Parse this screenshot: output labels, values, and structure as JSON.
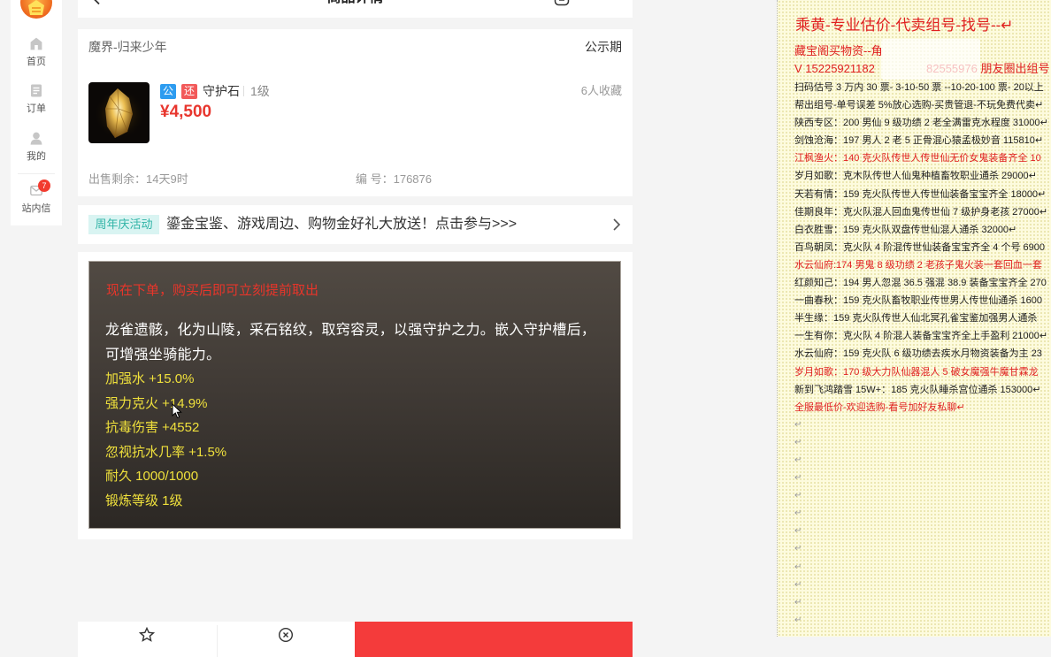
{
  "colors": {
    "accent_red": "#e8362e",
    "badge_public": "#2d9cf0",
    "badge_return": "#f25a5a",
    "promo_tag_bg": "#d9f4f2",
    "promo_tag_text": "#2fb3a6",
    "notice_red": "#e8352a",
    "attribute_yellow": "#efe03c",
    "doc_red": "#e02020",
    "buy_button": "#f43b3b"
  },
  "sidebar": {
    "logo_icon": "logo-icon",
    "items": [
      {
        "label": "首页",
        "icon": "home-icon"
      },
      {
        "label": "订单",
        "icon": "order-icon"
      },
      {
        "label": "我的",
        "icon": "user-icon"
      },
      {
        "label": "站内信",
        "icon": "message-icon",
        "badge": "7"
      }
    ]
  },
  "header": {
    "title": "商品详情",
    "back_icon": "chevron-left-icon",
    "action_icon": "share-icon"
  },
  "listing": {
    "server": "魔界-归来少年",
    "status": "公示期",
    "image": "guardian-stone-image",
    "badges": [
      "公",
      "还"
    ],
    "name": "守护石",
    "level": "1级",
    "price": "¥4,500",
    "favorites": "6人收藏",
    "time_left": "出售剩余：14天9时",
    "serial": "编 号：176876"
  },
  "promo": {
    "tag": "周年庆活动",
    "text": "鎏金宝鉴、游戏周边、购物金好礼大放送！点击参与>>>",
    "icon": "chevron-right-icon"
  },
  "description": {
    "notice": "现在下单，购买后即可立刻提前取出",
    "lore": "龙雀遗骸，化为山陵，采石铭纹，取窍容灵，以强守护之力。嵌入守护槽后，可增强坐骑能力。",
    "attributes": [
      "加强水 +15.0%",
      "强力克火 +14.9%",
      "抗毒伤害 +4552",
      "忽视抗水几率 +1.5%",
      "耐久 1000/1000",
      "锻炼等级 1级"
    ]
  },
  "bottom_bar": {
    "icons": [
      "star-icon",
      "circle-x-icon"
    ]
  },
  "notes_doc": {
    "title": "乘黄-专业估价-代卖组号-找号--↵",
    "header_lines": [
      "藏宝阁买物资--角",
      "V 15225921182"
    ],
    "contact_tail": "82555976 朋友圈出组号",
    "lines": [
      {
        "text": "扫码估号 3 万内 30 票- 3-10-50 票 --10-20-100 票- 20以上",
        "red": false
      },
      {
        "text": "帮出组号-单号误差 5%放心选购-买贵管退-不玩免费代卖↵",
        "red": false
      },
      {
        "text": "陕西专区：200 男仙 9 级功绩 2 老全满雷克水程度 31000↵",
        "red": false
      },
      {
        "text": "剑蚀沧海：197 男人 2 老 5 正骨混心猿孟极妙音 115810↵",
        "red": false
      },
      {
        "text": "江枫渔火：140 克火队传世人传世仙无价女鬼装备齐全 10",
        "red": true
      },
      {
        "text": "岁月如歌：克木队传世人仙鬼种植畜牧职业通杀 29000↵",
        "red": false
      },
      {
        "text": "天若有情：159 克火队传世人传世仙装备宝宝齐全 18000↵",
        "red": false
      },
      {
        "text": "佳期良年：克火队混人回血鬼传世仙 7 级护身老孩 27000↵",
        "red": false
      },
      {
        "text": "白衣胜雪：159 克火队双盘传世仙混人通杀 32000↵",
        "red": false
      },
      {
        "text": "百鸟朝凤：克火队 4 阶混传世仙装备宝宝齐全 4 个号 6900",
        "red": false
      },
      {
        "text": "水云仙府:174 男鬼 8 级功绩 2 老孩子鬼火装一套回血一套",
        "red": true
      },
      {
        "text": "红颜知己：194 男人忽混 36.5 强混 38.9 装备宝宝齐全 270",
        "red": false
      },
      {
        "text": "一曲春秋：159 克火队畜牧职业传世男人传世仙通杀 1600",
        "red": false
      },
      {
        "text": "半生缘：159 克火队传世人仙北冥孔雀宝鉴加强男人通杀",
        "red": false
      },
      {
        "text": "一生有你：克火队 4 阶混人装备宝宝齐全上手盈利 21000↵",
        "red": false
      },
      {
        "text": "水云仙府：159 克火队 6 级功绩去疾水月物资装备为主 23",
        "red": false
      },
      {
        "text": "岁月如歌：170 级大力队仙器混人 5 破女魔强牛魔甘霖龙",
        "red": true
      },
      {
        "text": "新到飞鸿踏雪 15W+：185 克火队睡杀宫位通杀 153000↵",
        "red": false
      },
      {
        "text": "全服最低价-欢迎选购-看号加好友私聊↵",
        "red": true
      }
    ],
    "empty_lines": [
      "↵",
      "↵",
      "↵",
      "↵",
      "↵",
      "↵",
      "↵",
      "↵",
      "↵",
      "↵",
      "↵",
      "↵"
    ]
  }
}
